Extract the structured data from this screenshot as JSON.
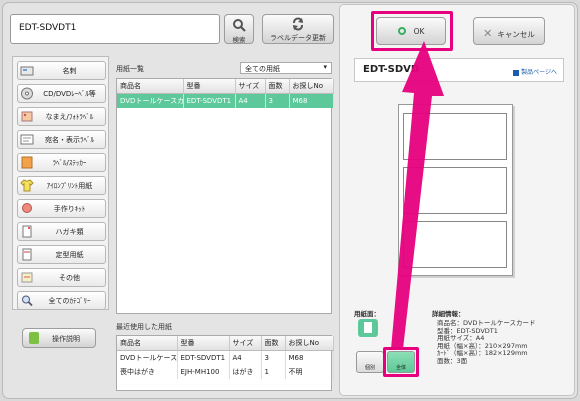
{
  "search": {
    "value": "EDT-SDVDT1",
    "button_label": "検索"
  },
  "update_button_label": "ラベルデータ更新",
  "categories": [
    {
      "label": "名刺"
    },
    {
      "label": "CD/DVDﾚｰﾍﾞﾙ等"
    },
    {
      "label": "なまえ/ﾌｫﾄﾗﾍﾞﾙ"
    },
    {
      "label": "宛名・表示ﾗﾍﾞﾙ"
    },
    {
      "label": "ﾗﾍﾞﾙ/ｽﾃｯｶｰ"
    },
    {
      "label": "ｱｲﾛﾝﾌﾟﾘﾝﾄ用紙"
    },
    {
      "label": "手作りｷｯﾄ"
    },
    {
      "label": "ハガキ類"
    },
    {
      "label": "定型用紙"
    },
    {
      "label": "その他"
    },
    {
      "label": "全てのｶﾃｺﾞﾘｰ"
    }
  ],
  "help_button_label": "操作説明",
  "paper_list": {
    "title": "用紙一覧",
    "filter": "全ての用紙",
    "columns": [
      "商品名",
      "型番",
      "サイズ",
      "面数",
      "お探しNo"
    ],
    "rows": [
      {
        "name": "DVDトールケースカー",
        "model": "EDT-SDVDT1",
        "size": "A4",
        "faces": "3",
        "no": "M68"
      }
    ]
  },
  "recent_list": {
    "title": "最近使用した用紙",
    "columns": [
      "商品名",
      "型番",
      "サイズ",
      "面数",
      "お探しNo"
    ],
    "rows": [
      {
        "name": "DVDトールケース",
        "model": "EDT-SDVDT1",
        "size": "A4",
        "faces": "3",
        "no": "M68"
      },
      {
        "name": "喪中はがき",
        "model": "EJH-MH100",
        "size": "はがき",
        "faces": "1",
        "no": "不明"
      }
    ]
  },
  "ok_label": "OK",
  "cancel_label": "キャンセル",
  "product": {
    "name": "EDT-SDVD",
    "link": "製品ページへ"
  },
  "paper_face_label": "用紙面：",
  "views": {
    "single": "個別",
    "whole": "全体"
  },
  "details": {
    "title": "詳細情報：",
    "lines": [
      "商品名：DVDトールケースカード",
      "型番：EDT-SDVDT1",
      "用紙サイズ：A4",
      "用紙（幅×高）：210×297mm",
      "ｶｰﾄﾞ（幅×高）：182×129mm",
      "面数：3面"
    ]
  },
  "colors": {
    "accent_highlight": "#e6007e",
    "selected_row": "#5dc899",
    "ok_icon": "#36b05d"
  }
}
